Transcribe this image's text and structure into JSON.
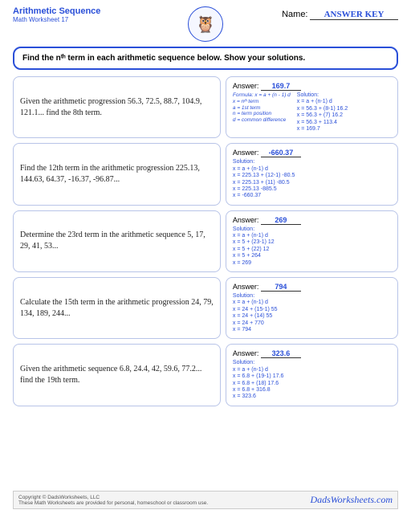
{
  "header": {
    "title": "Arithmetic Sequence",
    "subtitle": "Math Worksheet 17",
    "name_label": "Name:",
    "name_value": "ANSWER KEY"
  },
  "instruction": "Find the nᵗʰ term in each arithmetic sequence below.  Show your solutions.",
  "problems": [
    {
      "question": "Given the arithmetic progression 56.3, 72.5, 88.7, 104.9, 121.1... find the 8th term.",
      "answer": "169.7",
      "formula": "Formula:  x = a + (n - 1) d\nx = nᵗʰ term\na = 1st term\nn = term position\nd = common difference",
      "solution": "Solution:\nx = a + (n-1) d\nx = 56.3 +  (8-1) 16.2\nx = 56.3 + (7) 16.2\nx = 56.3 + 113.4\nx = 169.7"
    },
    {
      "question": "Find the 12th term in the arithmetic progression 225.13, 144.63, 64.37, -16.37, -96.87...",
      "answer": "-660.37",
      "solution": "Solution:\nx = a + (n-1) d\nx = 225.13 + (12-1) -80.5\nx = 225.13 + (11) -80.5\nx = 225.13 -885.5\nx = -660.37"
    },
    {
      "question": "Determine the 23rd term in the arithmetic sequence 5, 17, 29, 41, 53...",
      "answer": "269",
      "solution": "Solution:\nx = a + (n-1) d\nx = 5 + (23-1) 12\nx = 5 + (22) 12\nx = 5 + 264\nx = 269"
    },
    {
      "question": "Calculate the 15th term in the arithmetic progression 24, 79, 134, 189, 244...",
      "answer": "794",
      "solution": "Solution:\nx = a + (n-1) d\nx = 24 + (15-1) 55\nx = 24 + (14) 55\nx = 24 + 770\nx = 794"
    },
    {
      "question": "Given the arithmetic sequence 6.8, 24.4, 42, 59.6, 77.2... find the 19th term.",
      "answer": "323.6",
      "solution": "Solution:\nx = a + (n-1) d\nx = 6.8 + (19-1) 17.6\nx = 6.8 + (18) 17.6\nx = 6.8 + 316.8\nx = 323.6"
    }
  ],
  "footer": {
    "copyright": "Copyright © DadsWorksheets, LLC",
    "note": "These Math Worksheets are provided for personal, homeschool or classroom use.",
    "brand": "DadsWorksheets.com"
  },
  "labels": {
    "answer": "Answer:"
  }
}
